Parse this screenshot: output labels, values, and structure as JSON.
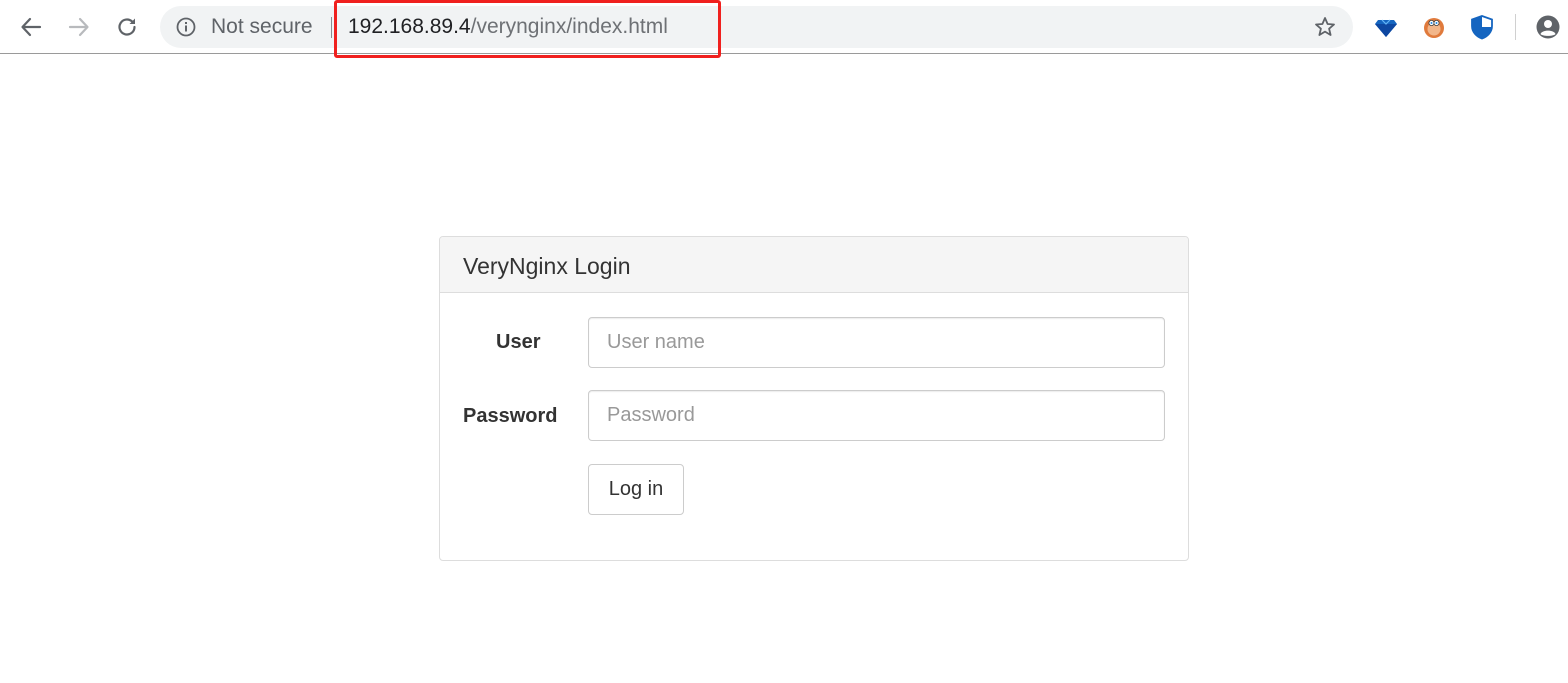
{
  "browser": {
    "security_label": "Not secure",
    "url_host": "192.168.89.4",
    "url_path": "/verynginx/index.html",
    "highlight_color": "#f0201e",
    "icons": {
      "back": "back-arrow-icon",
      "forward": "forward-arrow-icon",
      "reload": "reload-icon",
      "info": "info-icon",
      "star": "bookmark-star-icon",
      "extensions": [
        "diamond-extension-icon",
        "lion-extension-icon",
        "shield-extension-icon"
      ],
      "profile": "profile-avatar-icon"
    }
  },
  "login": {
    "title": "VeryNginx Login",
    "user_label": "User",
    "user_placeholder": "User name",
    "password_label": "Password",
    "password_placeholder": "Password",
    "submit_label": "Log in"
  }
}
